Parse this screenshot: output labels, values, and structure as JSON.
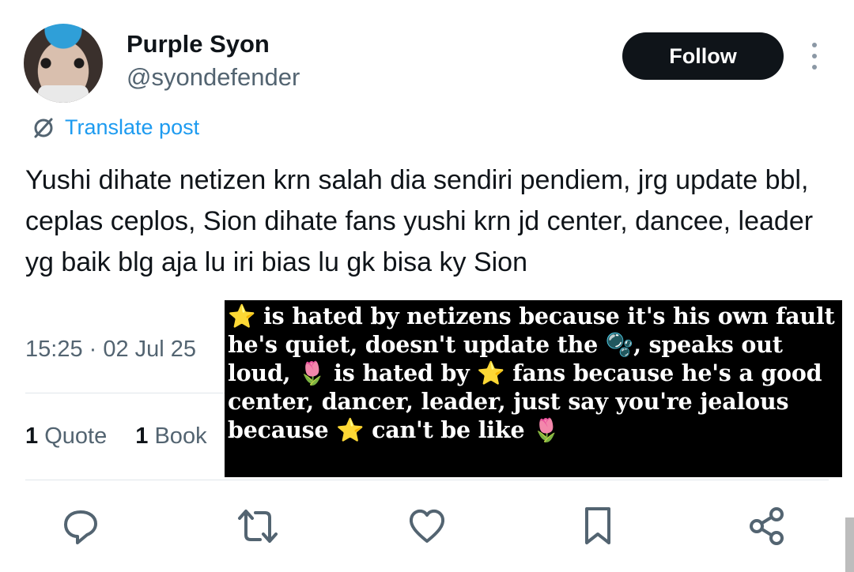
{
  "author": {
    "display_name": "Purple Syon",
    "handle": "@syondefender",
    "follow_label": "Follow"
  },
  "translate": {
    "label": "Translate post"
  },
  "post": {
    "text": "Yushi dihate netizen krn salah dia sendiri pendiem, jrg update bbl, ceplas ceplos, Sion dihate fans yushi krn jd center, dancee, leader yg baik blg aja lu iri bias lu gk bisa ky Sion",
    "timestamp": "15:25 · 02 Jul 25"
  },
  "stats": {
    "quotes_count": "1",
    "quotes_label": "Quote",
    "bookmarks_count": "1",
    "bookmarks_label": "Book"
  },
  "overlay": {
    "text": "⭐ is hated by netizens because it's his own fault he's quiet, doesn't update the 🫧, speaks out loud, 🌷 is hated by ⭐ fans because he's a good center, dancer, leader, just say you're jealous because ⭐ can't be like 🌷"
  },
  "actions": [
    "reply-icon",
    "repost-icon",
    "like-icon",
    "bookmark-icon",
    "share-icon"
  ],
  "colors": {
    "link": "#1d9bf0",
    "secondary_text": "#536471",
    "follow_bg": "#0f1419",
    "overlay_bg": "#000000"
  }
}
